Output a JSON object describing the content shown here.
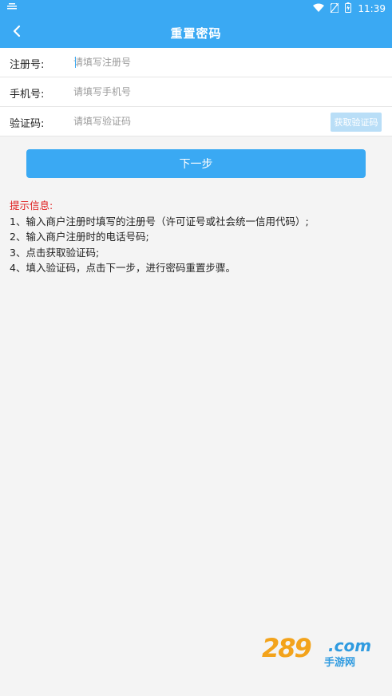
{
  "status": {
    "time": "11:39",
    "left_icon": "signal-strength-icon"
  },
  "header": {
    "title": "重置密码",
    "back_icon": "chevron-left-icon"
  },
  "form": {
    "rows": [
      {
        "label": "注册号:",
        "placeholder": "请填写注册号"
      },
      {
        "label": "手机号:",
        "placeholder": "请填写手机号"
      },
      {
        "label": "验证码:",
        "placeholder": "请填写验证码"
      }
    ],
    "get_code_label": "获取验证码"
  },
  "next_button": "下一步",
  "tips": {
    "title": "提示信息:",
    "items": [
      "1、输入商户注册时填写的注册号（许可证号或社会统一信用代码）;",
      "2、输入商户注册时的电话号码;",
      "3、点击获取验证码;",
      "4、填入验证码，点击下一步，进行密码重置步骤。"
    ]
  },
  "watermark": {
    "number": "289",
    "domain": ".com",
    "subtitle": "手游网"
  },
  "colors": {
    "primary": "#3aa9f3",
    "tip_title": "#e02020",
    "code_button": "#b9def7"
  }
}
